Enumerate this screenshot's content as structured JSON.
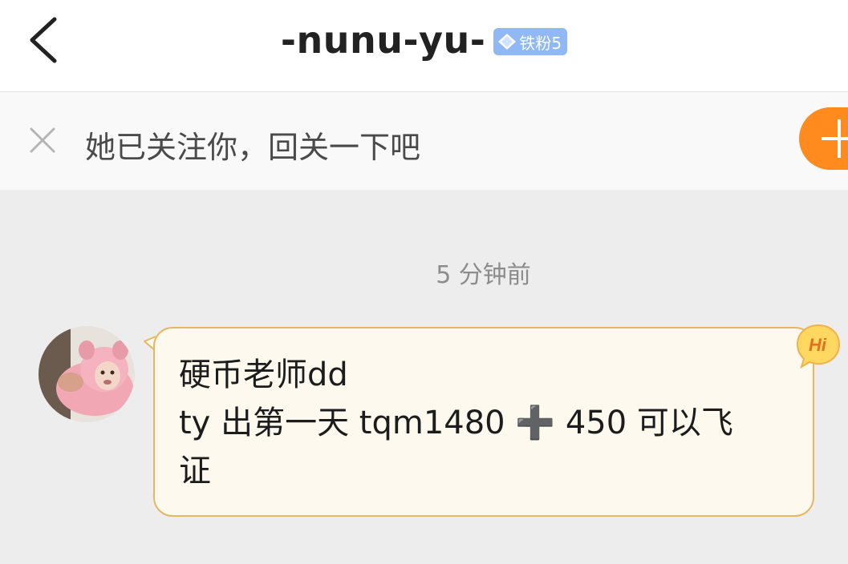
{
  "header": {
    "title": "-nunu-yu-",
    "fan_badge": {
      "icon": "diamond-icon",
      "label": "铁粉5"
    }
  },
  "follow_prompt": {
    "text": "她已关注你，回关一下吧",
    "button_icon": "plus-icon"
  },
  "chat": {
    "timestamp": "5 分钟前",
    "message": {
      "lines": [
        "硬币老师dd",
        "ty 出第一天 tqm1480 ➕ 450 可以飞",
        "证"
      ],
      "badge": "Hi"
    }
  },
  "colors": {
    "accent_orange": "#ff8a1e",
    "bubble_border": "#e9b660",
    "bubble_fill": "#fdf9ee",
    "badge_blue": "#8fb8f5"
  }
}
